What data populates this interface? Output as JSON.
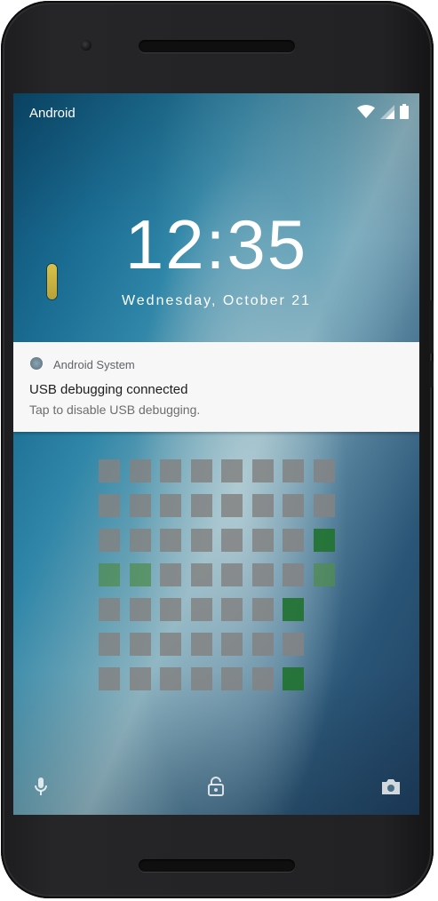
{
  "status_bar": {
    "carrier": "Android",
    "icons": [
      "wifi-icon",
      "signal-icon",
      "battery-icon"
    ]
  },
  "lockscreen": {
    "time": "12:35",
    "date": "Wednesday, October 21"
  },
  "notification": {
    "app_name": "Android System",
    "title": "USB debugging connected",
    "text": "Tap to disable USB debugging."
  },
  "pattern": {
    "rows": 7,
    "cols": 7,
    "cell_states": [
      [
        "gray",
        "gray",
        "gray",
        "gray",
        "gray",
        "gray",
        "gray",
        "gray"
      ],
      [
        "gray",
        "gray",
        "gray",
        "gray",
        "gray",
        "gray",
        "gray",
        "gray"
      ],
      [
        "gray",
        "gray",
        "gray",
        "gray",
        "gray",
        "gray",
        "gray",
        "green-dark"
      ],
      [
        "green-light",
        "green-light",
        "gray",
        "gray",
        "gray",
        "gray",
        "gray",
        "green-light"
      ],
      [
        "gray",
        "gray",
        "gray",
        "gray",
        "gray",
        "gray",
        "green-dark"
      ],
      [
        "gray",
        "gray",
        "gray",
        "gray",
        "gray",
        "gray",
        "gray"
      ],
      [
        "gray",
        "gray",
        "gray",
        "gray",
        "gray",
        "gray",
        "green-dark"
      ]
    ]
  },
  "bottom_bar": {
    "left_icon": "microphone-icon",
    "center_icon": "lock-icon",
    "right_icon": "camera-icon"
  },
  "colors": {
    "notification_bg": "#f7f7f7",
    "pattern_gray": "#828282",
    "pattern_green_light": "#508c50",
    "pattern_green_dark": "#237332"
  }
}
